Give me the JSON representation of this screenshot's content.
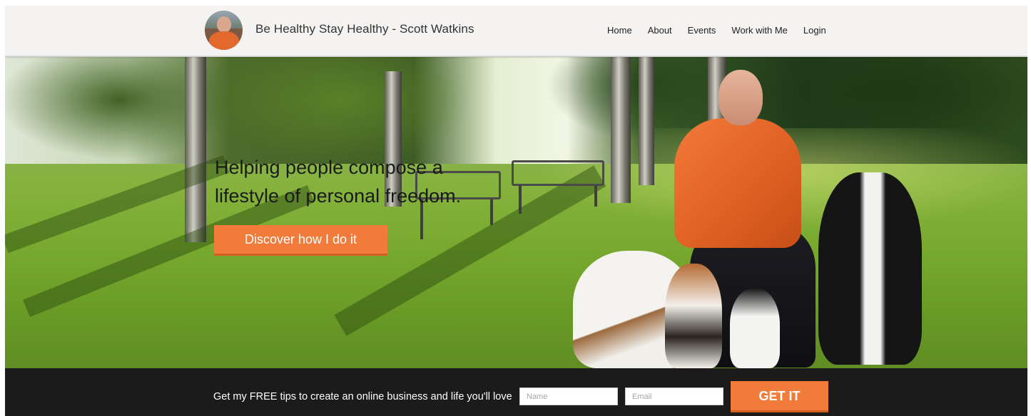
{
  "header": {
    "site_title": "Be Healthy Stay Healthy - Scott Watkins",
    "nav": [
      "Home",
      "About",
      "Events",
      "Work with Me",
      "Login"
    ]
  },
  "hero": {
    "headline_line1": "Helping people compose a",
    "headline_line2": "lifestyle of personal freedom.",
    "cta_label": "Discover how I do it"
  },
  "optin": {
    "text": "Get my FREE tips to create an online business and life you'll love",
    "name_placeholder": "Name",
    "email_placeholder": "Email",
    "button_label": "GET IT"
  },
  "colors": {
    "accent": "#f07b3a",
    "footer_bg": "#1b1b1b",
    "header_bg": "#f4f3f2"
  }
}
